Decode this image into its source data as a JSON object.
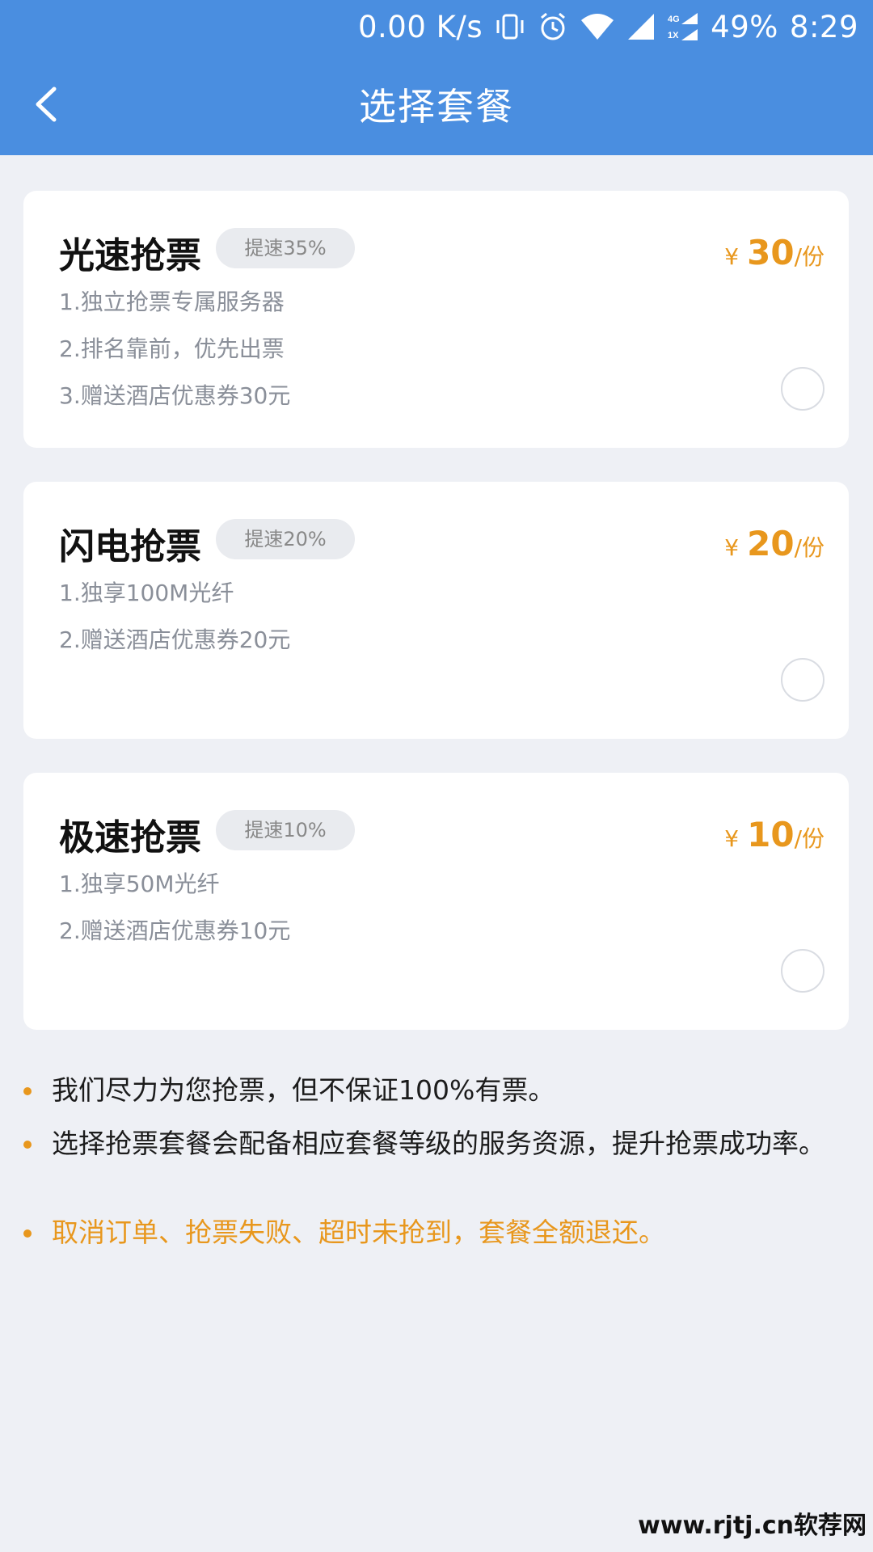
{
  "status_bar": {
    "net_speed": "0.00 K/s",
    "battery": "49%",
    "time": "8:29",
    "icons": [
      "vibrate-icon",
      "alarm-icon",
      "wifi-icon",
      "signal-icon",
      "4g-1x-signal-icon"
    ]
  },
  "nav": {
    "title": "选择套餐",
    "back_icon": "chevron-left-icon"
  },
  "packages": [
    {
      "title": "光速抢票",
      "badge": "提速35%",
      "price_symbol": "¥",
      "price": "30",
      "unit": "/份",
      "features": [
        "1.独立抢票专属服务器",
        "2.排名靠前，优先出票",
        "3.赠送酒店优惠券30元"
      ]
    },
    {
      "title": "闪电抢票",
      "badge": "提速20%",
      "price_symbol": "¥",
      "price": "20",
      "unit": "/份",
      "features": [
        "1.独享100M光纤",
        "2.赠送酒店优惠券20元"
      ]
    },
    {
      "title": "极速抢票",
      "badge": "提速10%",
      "price_symbol": "¥",
      "price": "10",
      "unit": "/份",
      "features": [
        "1.独享50M光纤",
        "2.赠送酒店优惠券10元"
      ]
    }
  ],
  "notes": [
    "我们尽力为您抢票，但不保证100%有票。",
    "选择抢票套餐会配备相应套餐等级的服务资源，提升抢票成功率。",
    "取消订单、抢票失败、超时未抢到，套餐全额退还。"
  ],
  "watermark": "www.rjtj.cn软荐网",
  "colors": {
    "header": "#4a8ee0",
    "accent": "#e8971d",
    "background": "#eef0f5"
  }
}
